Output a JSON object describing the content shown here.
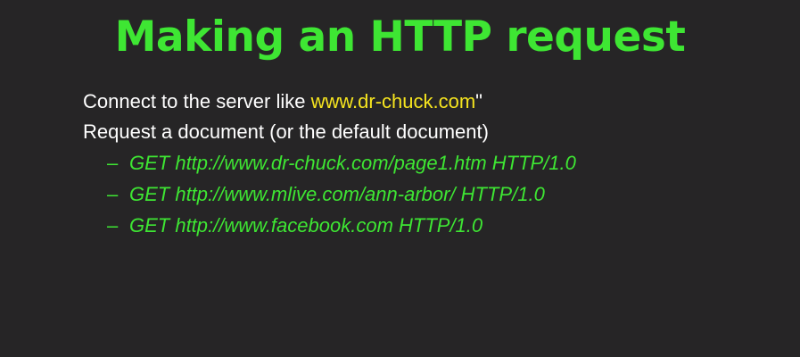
{
  "slide": {
    "title": "Making an HTTP request",
    "bullets": [
      {
        "before": "Connect to the server like ",
        "highlight": "www.dr-chuck.com",
        "after": "\""
      },
      {
        "text": "Request a document (or the default document)"
      }
    ],
    "sub_bullets": [
      {
        "marker": "–",
        "text": "GET http://www.dr-chuck.com/page1.htm HTTP/1.0"
      },
      {
        "marker": "–",
        "text": "GET http://www.mlive.com/ann-arbor/ HTTP/1.0"
      },
      {
        "marker": "–",
        "text": "GET http://www.facebook.com HTTP/1.0"
      }
    ],
    "colors": {
      "background": "#262526",
      "title": "#3ee633",
      "body_text": "#ffffff",
      "highlight": "#f5e41f",
      "sub_text": "#3ee633"
    }
  }
}
